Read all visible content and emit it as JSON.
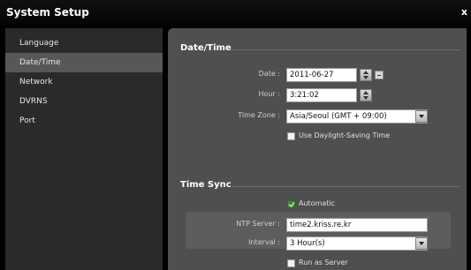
{
  "window": {
    "title": "System Setup",
    "close_glyph": "x"
  },
  "sidebar": {
    "items": [
      {
        "label": "Language"
      },
      {
        "label": "Date/Time"
      },
      {
        "label": "Network"
      },
      {
        "label": "DVRNS"
      },
      {
        "label": "Port"
      }
    ]
  },
  "datetime": {
    "heading": "Date/Time",
    "date_label": "Date :",
    "date_value": "2011-06-27",
    "hour_label": "Hour :",
    "hour_value": "3:21:02",
    "timezone_label": "Time Zone :",
    "timezone_value": "Asia/Seoul (GMT + 09:00)",
    "dst_label": "Use Daylight-Saving Time",
    "dst_checked": false
  },
  "timesync": {
    "heading": "Time Sync",
    "automatic_label": "Automatic",
    "automatic_checked": true,
    "ntp_label": "NTP Server :",
    "ntp_value": "time2.kriss.re.kr",
    "interval_label": "Interval :",
    "interval_value": "3 Hour(s)",
    "run_server_label": "Run as Server",
    "run_server_checked": false
  },
  "colors": {
    "sidebar_bg": "#2a2a2a",
    "sidebar_active": "#575757",
    "panel_bg": "#4f4f4f",
    "checkbox_checked": "#3a8e2a"
  }
}
